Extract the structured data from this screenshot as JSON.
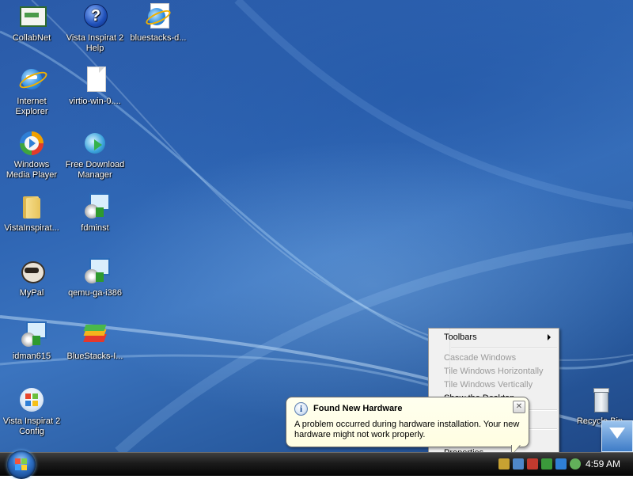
{
  "desktop": {
    "icons": [
      {
        "label": "CollabNet",
        "icon": "collabnet-icon"
      },
      {
        "label": "Vista Inspirat 2 Help",
        "icon": "help-icon"
      },
      {
        "label": "bluestacks-d...",
        "icon": "internet-explorer-icon"
      },
      {
        "label": "Internet Explorer",
        "icon": "internet-explorer-icon"
      },
      {
        "label": "virtio-win-0....",
        "icon": "file-icon"
      },
      {
        "label": "Windows Media Player",
        "icon": "media-player-icon"
      },
      {
        "label": "Free Download Manager",
        "icon": "download-manager-icon"
      },
      {
        "label": "VistaInspirat...",
        "icon": "folder-icon"
      },
      {
        "label": "fdminst",
        "icon": "installer-icon"
      },
      {
        "label": "MyPal",
        "icon": "mypal-icon"
      },
      {
        "label": "qemu-ga-i386",
        "icon": "installer-icon"
      },
      {
        "label": "idman615",
        "icon": "installer-icon"
      },
      {
        "label": "BlueStacks-I...",
        "icon": "bluestacks-icon"
      },
      {
        "label": "Vista Inspirat 2 Config",
        "icon": "windows-logo-icon"
      },
      {
        "label": "Recycle Bin",
        "icon": "recycle-bin-icon"
      }
    ]
  },
  "context_menu": {
    "toolbars": "Toolbars",
    "cascade": "Cascade Windows",
    "tile_h": "Tile Windows Horizontally",
    "tile_v": "Tile Windows Vertically",
    "show_desktop": "Show the Desktop",
    "properties": "Properties"
  },
  "balloon": {
    "title": "Found New Hardware",
    "text": "A problem occurred during hardware installation. Your new hardware might not work properly.",
    "close_glyph": "✕",
    "info_glyph": "i"
  },
  "taskbar": {
    "clock": "4:59 AM"
  },
  "colors": {
    "desktop": "#2f66b4",
    "taskbar": "#1b1b1b",
    "balloon": "#fffee1",
    "menu": "#f0f0f0"
  }
}
